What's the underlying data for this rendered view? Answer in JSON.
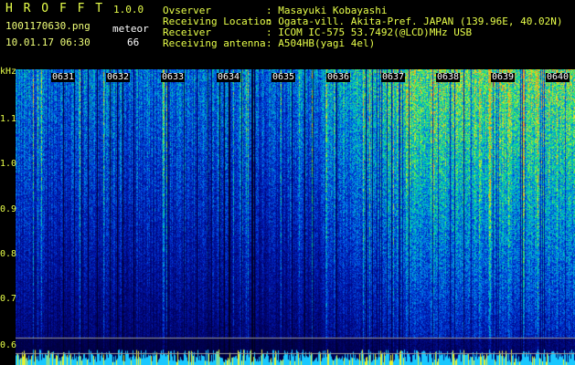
{
  "app": {
    "name": "H R O F F T",
    "version": "1.0.0"
  },
  "file": {
    "name": "1001170630.png",
    "datetime": "10.01.17 06:30"
  },
  "meteor": {
    "label": "meteor",
    "count": "66"
  },
  "station": {
    "observer_label": "Ovserver",
    "observer": ": Masayuki Kobayashi",
    "location_label": "Receiving Location",
    "location": ": Ogata-vill. Akita-Pref. JAPAN (139.96E, 40.02N)",
    "receiver_label": "Receiver",
    "receiver": ": ICOM IC-575 53.7492(@LCD)MHz USB",
    "antenna_label": "Receiving antenna",
    "antenna": ": A504HB(yagi 4el)"
  },
  "axis": {
    "unit": "kHz",
    "y_ticks": [
      "1.1",
      "1.0",
      "0.9",
      "0.8",
      "0.7",
      "0.6"
    ],
    "time_ticks": [
      "0631",
      "0632",
      "0633",
      "0634",
      "0635",
      "0636",
      "0637",
      "0638",
      "0639",
      "0640"
    ]
  },
  "colors": {
    "header_yellow": "#e8ff4a",
    "header_white": "#ffffff",
    "background": "#000000"
  }
}
